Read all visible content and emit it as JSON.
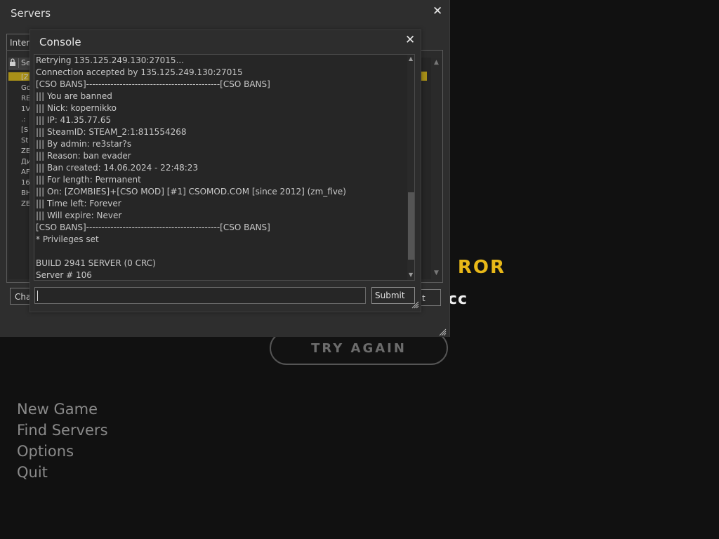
{
  "background": {
    "error_title": "ROR",
    "error_subtitle": "cc",
    "try_again_label": "TRY AGAIN",
    "menu": [
      "New Game",
      "Find Servers",
      "Options",
      "Quit"
    ],
    "accent_color": "#e8b818"
  },
  "servers_window": {
    "title": "Servers",
    "close_label": "✕",
    "tab_label": "Inter",
    "column_header": "Se",
    "rows": [
      "[Z",
      "Go",
      "RE",
      "1V",
      ".:",
      "[S",
      "St",
      "ZE",
      "Ди",
      "AF",
      "16",
      "BH",
      "ZE"
    ],
    "left_button_label": "Cha",
    "right_button_label": "t"
  },
  "console_window": {
    "title": "Console",
    "close_label": "✕",
    "log": [
      "Retrying 135.125.249.130:27015...",
      "Connection accepted by 135.125.249.130:27015",
      "[CSO BANS]--------------------------------------------[CSO BANS]",
      "||| You are banned",
      "||| Nick: kopernikko",
      "||| IP: 41.35.77.65",
      "||| SteamID: STEAM_2:1:811554268",
      "||| By admin: re3star?s",
      "||| Reason: ban evader",
      "||| Ban created: 14.06.2024 - 22:48:23",
      "||| For length: Permanent",
      "||| On: [ZOMBIES]+[CSO MOD] [#1] CSOMOD.COM [since 2012] (zm_five)",
      "||| Time left: Forever",
      "||| Will expire: Never",
      "[CSO BANS]--------------------------------------------[CSO BANS]",
      "* Privileges set",
      "",
      "BUILD 2941 SERVER (0 CRC)",
      "Server # 106"
    ],
    "input_value": "",
    "submit_label": "Submit"
  }
}
